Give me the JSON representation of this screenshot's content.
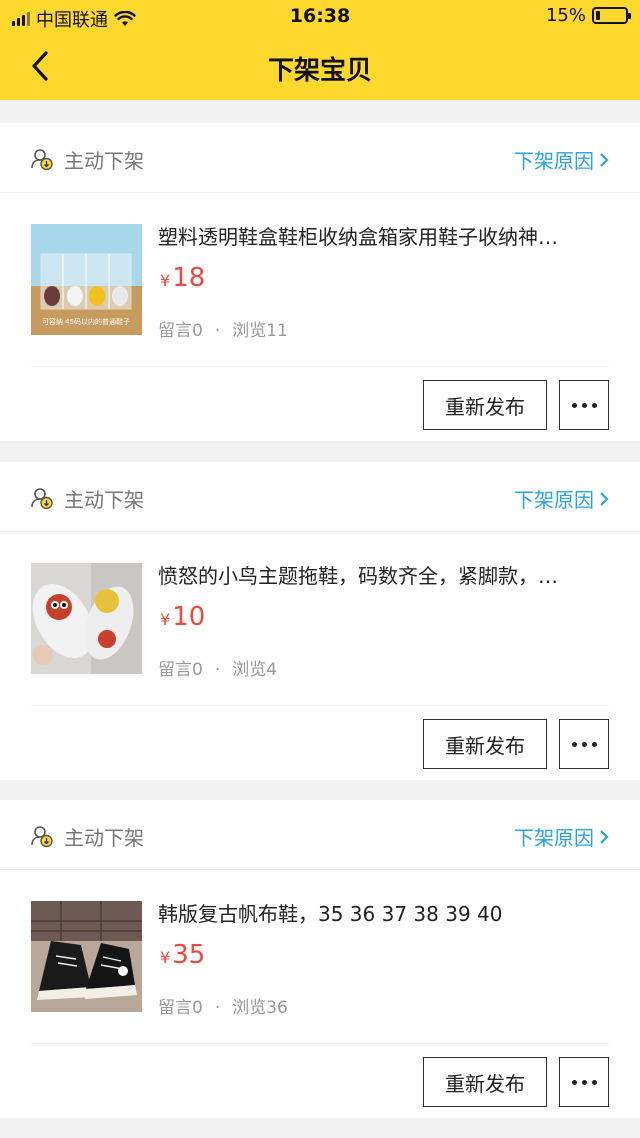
{
  "status_bar": {
    "carrier": "中国联通",
    "time": "16:38",
    "battery": "15%",
    "battery_level": 0.15
  },
  "nav": {
    "title": "下架宝贝",
    "back_icon": "chevron-left-icon"
  },
  "colors": {
    "accent": "#ffd82e",
    "link": "#2aa3e6",
    "price": "#f0463b"
  },
  "items": [
    {
      "status_label": "主动下架",
      "reason_label": "下架原因",
      "title": "塑料透明鞋盒鞋柜收纳盒箱家用鞋子收纳神…",
      "currency": "¥",
      "price": "18",
      "comments": "留言0",
      "separator": "·",
      "views": "浏览11",
      "image_caption": "可容纳 45码以内的普通鞋子",
      "republish_label": "重新发布"
    },
    {
      "status_label": "主动下架",
      "reason_label": "下架原因",
      "title": "愤怒的小鸟主题拖鞋，码数齐全，紧脚款，…",
      "currency": "¥",
      "price": "10",
      "comments": "留言0",
      "separator": "·",
      "views": "浏览4",
      "republish_label": "重新发布"
    },
    {
      "status_label": "主动下架",
      "reason_label": "下架原因",
      "title": "韩版复古帆布鞋，35  36  37 38  39  40",
      "currency": "¥",
      "price": "35",
      "comments": "留言0",
      "separator": "·",
      "views": "浏览36",
      "republish_label": "重新发布"
    }
  ]
}
